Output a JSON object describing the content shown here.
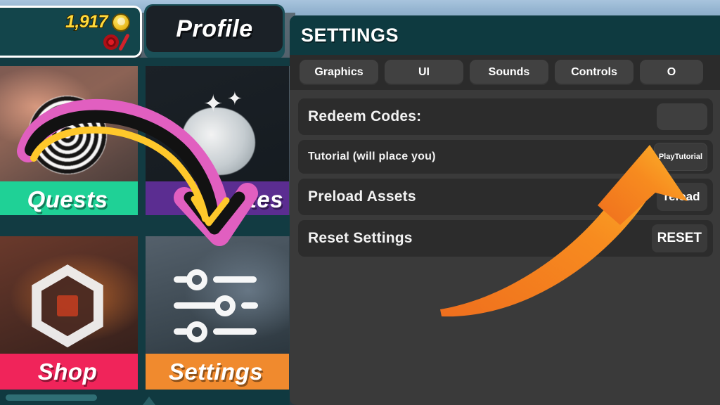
{
  "hud": {
    "currency_amount": "1,917",
    "currency_icon": "gold-coin-icon",
    "robux_icon": "robux-zero-icon",
    "profile_label": "Profile"
  },
  "menu_tiles": [
    {
      "label": "Quests",
      "icon": "spiral-icon",
      "accent": "#1fd196"
    },
    {
      "label": "ates",
      "icon": "crate-icon",
      "accent": "#5b2d91"
    },
    {
      "label": "Shop",
      "icon": "roblox-logo-icon",
      "accent": "#f0245a"
    },
    {
      "label": "Settings",
      "icon": "sliders-icon",
      "accent": "#f08a2e"
    }
  ],
  "settings_panel": {
    "title": "SETTINGS",
    "tabs": [
      {
        "label": "Graphics"
      },
      {
        "label": "UI"
      },
      {
        "label": "Sounds"
      },
      {
        "label": "Controls"
      },
      {
        "label": "O"
      }
    ],
    "rows": [
      {
        "label": "Redeem Codes:",
        "control": "input",
        "value": "",
        "placeholder": ""
      },
      {
        "label": "Tutorial (will place you)",
        "control": "button",
        "button_label": "Play\nTutorial"
      },
      {
        "label": "Preload Assets",
        "control": "button",
        "button_label": "reload"
      },
      {
        "label": "Reset Settings",
        "control": "button",
        "button_label": "RESET"
      }
    ]
  },
  "annotations": {
    "orange_arrow": {
      "name": "orange-pointer-arrow",
      "color": "#f58220",
      "points_to": "Play Tutorial"
    },
    "drawn_arrow": {
      "name": "drawn-curved-arrow",
      "outline_color": "#e15fc0",
      "core_color": "#111111",
      "highlight_color": "#ffc82b",
      "points_to": "Settings"
    }
  },
  "colors": {
    "panel_bg": "#3a3a3a",
    "header_teal": "#0e3a40",
    "row_bg": "#2c2c2c",
    "tab_bg": "#414141",
    "coin_gold": "#ffd93b",
    "orange": "#f58220"
  }
}
